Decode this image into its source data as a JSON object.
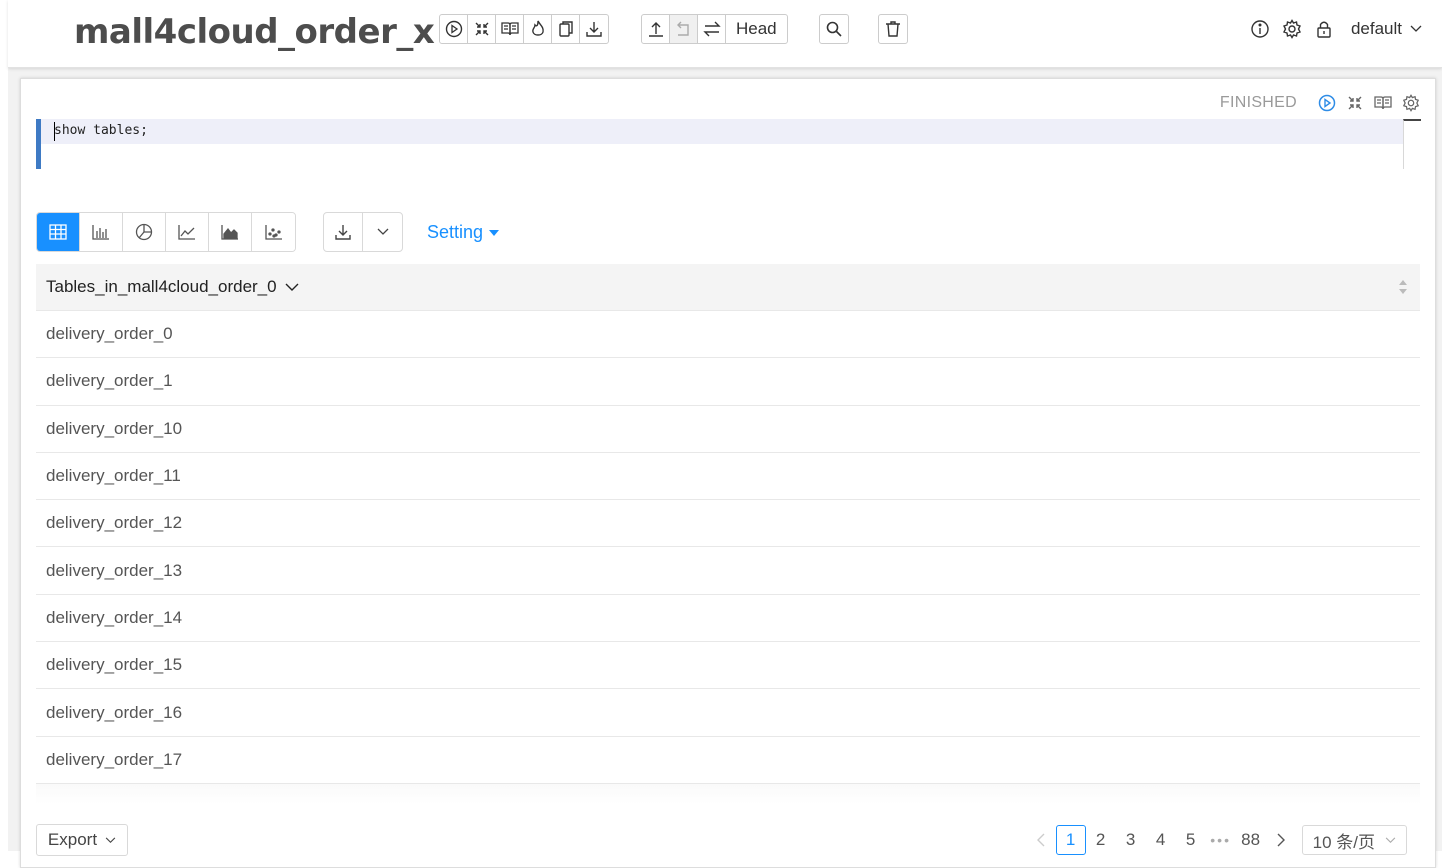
{
  "header": {
    "title": "mall4cloud_order_x",
    "toolbar_icons": [
      "run-all-icon",
      "show-hide-code-icon",
      "show-hide-output-icon",
      "clear-output-icon",
      "clone-icon",
      "export-icon"
    ],
    "version_icons": [
      "commit-icon",
      "revert-icon",
      "compare-icon"
    ],
    "version_label": "Head",
    "search_icon": "search-icon",
    "delete_icon": "trash-icon",
    "profile": "default"
  },
  "paragraph": {
    "status": "FINISHED",
    "code": "show tables;",
    "viz_buttons": [
      "table-icon",
      "bar-chart-icon",
      "pie-chart-icon",
      "line-chart-icon",
      "area-chart-icon",
      "scatter-chart-icon"
    ],
    "setting_label": "Setting"
  },
  "table": {
    "column": "Tables_in_mall4cloud_order_0",
    "rows": [
      "delivery_order_0",
      "delivery_order_1",
      "delivery_order_10",
      "delivery_order_11",
      "delivery_order_12",
      "delivery_order_13",
      "delivery_order_14",
      "delivery_order_15",
      "delivery_order_16",
      "delivery_order_17"
    ]
  },
  "footer": {
    "export_label": "Export",
    "pages": [
      "1",
      "2",
      "3",
      "4",
      "5"
    ],
    "ellipsis": "•••",
    "last_page": "88",
    "current_page": "1",
    "page_size": "10 条/页"
  },
  "colors": {
    "accent": "#1890ff",
    "editor_bar": "#3e7ac4",
    "editor_line": "#eeeff9"
  }
}
